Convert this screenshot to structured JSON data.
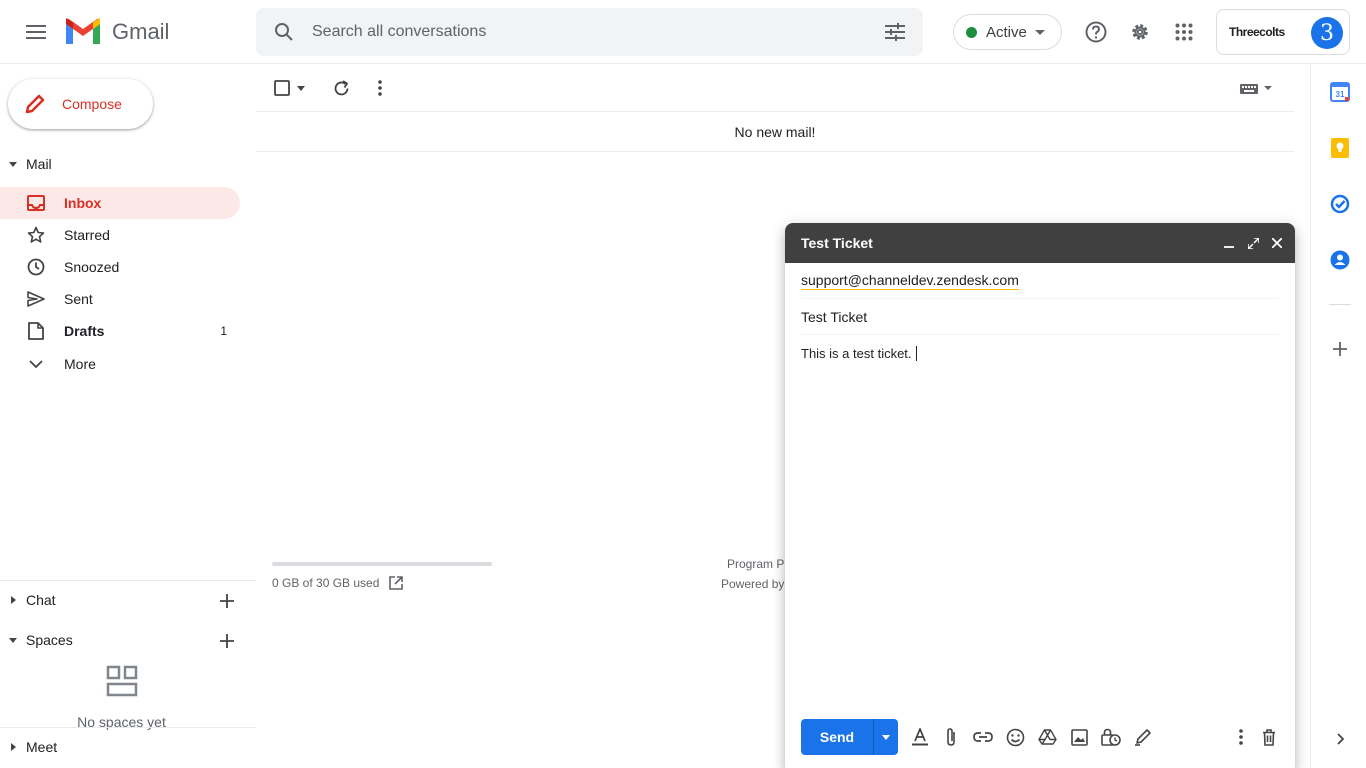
{
  "header": {
    "app_name": "Gmail",
    "search_placeholder": "Search all conversations",
    "status_label": "Active",
    "org_name": "Threecolts",
    "avatar_letter": "3"
  },
  "compose_button": {
    "label": "Compose"
  },
  "mail_section": {
    "label": "Mail"
  },
  "nav": {
    "inbox": "Inbox",
    "starred": "Starred",
    "snoozed": "Snoozed",
    "sent": "Sent",
    "drafts": "Drafts",
    "drafts_count": "1",
    "more": "More"
  },
  "chat_section": {
    "label": "Chat"
  },
  "spaces_section": {
    "label": "Spaces",
    "empty_text": "No spaces yet"
  },
  "meet_section": {
    "label": "Meet"
  },
  "main": {
    "no_mail_text": "No new mail!",
    "storage_text": "0 GB of 30 GB used",
    "storage_used_fraction": 0,
    "footer_line1": "Program P",
    "footer_line2": "Powered by"
  },
  "compose_window": {
    "title": "Test Ticket",
    "recipient": "support@channeldev.zendesk.com",
    "subject": "Test Ticket",
    "body": "This is a test ticket.",
    "send_label": "Send"
  },
  "right_apps": [
    "calendar-icon",
    "keep-icon",
    "tasks-icon",
    "contacts-icon"
  ],
  "colors": {
    "brand_red": "#d93025",
    "accent_blue": "#1a73e8",
    "active_green": "#1e8e3e",
    "inbox_highlight": "#fce8e6",
    "compose_header": "#404040"
  }
}
